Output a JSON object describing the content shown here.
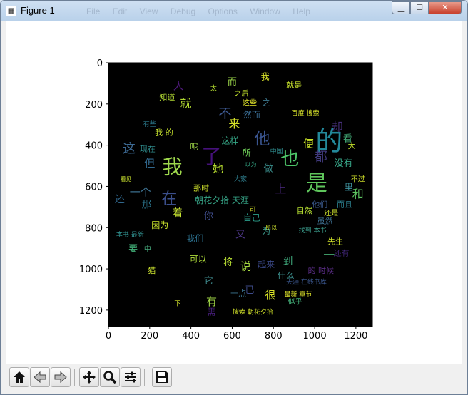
{
  "window": {
    "title": "Figure 1",
    "ghost_menu": "File  Edit  View  Debug  Options  Window  Help",
    "buttons": {
      "minimize": "minimize-icon",
      "maximize": "maximize-icon",
      "close": "close-icon"
    }
  },
  "toolbar": {
    "items": [
      {
        "name": "home-button",
        "icon": "home-icon"
      },
      {
        "name": "back-button",
        "icon": "back-arrow-icon"
      },
      {
        "name": "forward-button",
        "icon": "forward-arrow-icon"
      },
      {
        "name": "pan-button",
        "icon": "move-icon"
      },
      {
        "name": "zoom-button",
        "icon": "magnifier-icon"
      },
      {
        "name": "configure-subplots-button",
        "icon": "sliders-icon"
      },
      {
        "name": "save-button",
        "icon": "floppy-disk-icon"
      }
    ]
  },
  "chart_data": {
    "type": "wordcloud",
    "xticks": [
      0,
      200,
      400,
      600,
      800,
      1000,
      1200
    ],
    "yticks": [
      0,
      200,
      400,
      600,
      800,
      1000,
      1200
    ],
    "xlim": [
      0,
      1280
    ],
    "ylim": [
      1280,
      0
    ],
    "background": "#000000",
    "words": [
      {
        "text": "的",
        "x": 1070,
        "y": 390,
        "size": 38,
        "color": "#23889a"
      },
      {
        "text": "是",
        "x": 1010,
        "y": 590,
        "size": 30,
        "color": "#5fc65c"
      },
      {
        "text": "我",
        "x": 310,
        "y": 510,
        "size": 28,
        "color": "#9ed84c"
      },
      {
        "text": "了",
        "x": 500,
        "y": 460,
        "size": 28,
        "color": "#45117a"
      },
      {
        "text": "也",
        "x": 880,
        "y": 470,
        "size": 26,
        "color": "#4ec76a"
      },
      {
        "text": "他",
        "x": 745,
        "y": 375,
        "size": 22,
        "color": "#3a5590"
      },
      {
        "text": "在",
        "x": 295,
        "y": 665,
        "size": 22,
        "color": "#3b4f8c"
      },
      {
        "text": "这",
        "x": 100,
        "y": 420,
        "size": 18,
        "color": "#3d6a94"
      },
      {
        "text": "不",
        "x": 565,
        "y": 250,
        "size": 18,
        "color": "#3e5a93"
      },
      {
        "text": "都",
        "x": 1030,
        "y": 460,
        "size": 18,
        "color": "#40397c"
      },
      {
        "text": "却",
        "x": 1110,
        "y": 315,
        "size": 16,
        "color": "#462f7a"
      },
      {
        "text": "就",
        "x": 375,
        "y": 200,
        "size": 16,
        "color": "#b4dc32"
      },
      {
        "text": "人",
        "x": 340,
        "y": 115,
        "size": 15,
        "color": "#50197e"
      },
      {
        "text": "而",
        "x": 600,
        "y": 95,
        "size": 13,
        "color": "#9dd94a"
      },
      {
        "text": "来",
        "x": 610,
        "y": 300,
        "size": 16,
        "color": "#d6e228"
      },
      {
        "text": "便",
        "x": 970,
        "y": 395,
        "size": 15,
        "color": "#c9e228"
      },
      {
        "text": "看",
        "x": 1160,
        "y": 370,
        "size": 13,
        "color": "#44b07a"
      },
      {
        "text": "没有",
        "x": 1140,
        "y": 490,
        "size": 13,
        "color": "#38a88a"
      },
      {
        "text": "和",
        "x": 1210,
        "y": 640,
        "size": 16,
        "color": "#5ec662"
      },
      {
        "text": "上",
        "x": 835,
        "y": 615,
        "size": 16,
        "color": "#4e2a84"
      },
      {
        "text": "但",
        "x": 200,
        "y": 490,
        "size": 15,
        "color": "#31688e"
      },
      {
        "text": "一个",
        "x": 155,
        "y": 630,
        "size": 15,
        "color": "#3d7190"
      },
      {
        "text": "还",
        "x": 55,
        "y": 665,
        "size": 14,
        "color": "#31688e"
      },
      {
        "text": "那",
        "x": 185,
        "y": 690,
        "size": 14,
        "color": "#2d7891"
      },
      {
        "text": "着",
        "x": 335,
        "y": 730,
        "size": 15,
        "color": "#c5e132"
      },
      {
        "text": "你",
        "x": 485,
        "y": 745,
        "size": 13,
        "color": "#3e4c8a"
      },
      {
        "text": "她",
        "x": 530,
        "y": 515,
        "size": 15,
        "color": "#b9de30"
      },
      {
        "text": "做",
        "x": 775,
        "y": 515,
        "size": 13,
        "color": "#3a8e8c"
      },
      {
        "text": "所",
        "x": 670,
        "y": 440,
        "size": 12,
        "color": "#6ecf58"
      },
      {
        "text": "这样",
        "x": 590,
        "y": 380,
        "size": 12,
        "color": "#35a484"
      },
      {
        "text": "然而",
        "x": 695,
        "y": 255,
        "size": 12,
        "color": "#3a6d94"
      },
      {
        "text": "朝花夕拾 天涯",
        "x": 550,
        "y": 670,
        "size": 12,
        "color": "#35a184"
      },
      {
        "text": "自己",
        "x": 695,
        "y": 755,
        "size": 12,
        "color": "#2c9f8c"
      },
      {
        "text": "又",
        "x": 640,
        "y": 835,
        "size": 14,
        "color": "#4a3583"
      },
      {
        "text": "为",
        "x": 765,
        "y": 820,
        "size": 12,
        "color": "#3c9a8c"
      },
      {
        "text": "我们",
        "x": 420,
        "y": 855,
        "size": 12,
        "color": "#2c718f"
      },
      {
        "text": "因为",
        "x": 250,
        "y": 790,
        "size": 12,
        "color": "#c8e02c"
      },
      {
        "text": "要",
        "x": 120,
        "y": 905,
        "size": 13,
        "color": "#43b27a"
      },
      {
        "text": "中",
        "x": 190,
        "y": 905,
        "size": 10,
        "color": "#46a97c"
      },
      {
        "text": "可以",
        "x": 435,
        "y": 955,
        "size": 12,
        "color": "#aedb3a"
      },
      {
        "text": "将",
        "x": 580,
        "y": 970,
        "size": 13,
        "color": "#b7dd32"
      },
      {
        "text": "说",
        "x": 665,
        "y": 990,
        "size": 15,
        "color": "#a5d840"
      },
      {
        "text": "起来",
        "x": 765,
        "y": 980,
        "size": 12,
        "color": "#3c4a8b"
      },
      {
        "text": "到",
        "x": 870,
        "y": 965,
        "size": 14,
        "color": "#40ac7e"
      },
      {
        "text": "一",
        "x": 1070,
        "y": 935,
        "size": 16,
        "color": "#49b87a"
      },
      {
        "text": "还有",
        "x": 1130,
        "y": 925,
        "size": 11,
        "color": "#43277c"
      },
      {
        "text": "先生",
        "x": 1100,
        "y": 870,
        "size": 11,
        "color": "#d0e22a"
      },
      {
        "text": "什么",
        "x": 860,
        "y": 1035,
        "size": 12,
        "color": "#3b8e8c"
      },
      {
        "text": "的 时候",
        "x": 1030,
        "y": 1010,
        "size": 11,
        "color": "#5a2d86"
      },
      {
        "text": "虽然",
        "x": 1050,
        "y": 770,
        "size": 11,
        "color": "#3d6f90"
      },
      {
        "text": "还是",
        "x": 1080,
        "y": 730,
        "size": 10,
        "color": "#cde02c"
      },
      {
        "text": "他们",
        "x": 1025,
        "y": 690,
        "size": 11,
        "color": "#3b5a8f"
      },
      {
        "text": "而且",
        "x": 1145,
        "y": 690,
        "size": 11,
        "color": "#2c7f8e"
      },
      {
        "text": "自然",
        "x": 950,
        "y": 720,
        "size": 11,
        "color": "#b5de32"
      },
      {
        "text": "不过",
        "x": 1210,
        "y": 565,
        "size": 10,
        "color": "#d2e22a"
      },
      {
        "text": "里",
        "x": 1165,
        "y": 605,
        "size": 12,
        "color": "#3f94a0"
      },
      {
        "text": "很",
        "x": 785,
        "y": 1130,
        "size": 15,
        "color": "#d8e228"
      },
      {
        "text": "已",
        "x": 685,
        "y": 1105,
        "size": 13,
        "color": "#3e4b8a"
      },
      {
        "text": "一点",
        "x": 630,
        "y": 1120,
        "size": 11,
        "color": "#3c7490"
      },
      {
        "text": "它",
        "x": 485,
        "y": 1060,
        "size": 13,
        "color": "#3f8b8e"
      },
      {
        "text": "有",
        "x": 500,
        "y": 1160,
        "size": 15,
        "color": "#a0d646"
      },
      {
        "text": "需",
        "x": 500,
        "y": 1210,
        "size": 12,
        "color": "#4a1f80"
      },
      {
        "text": "猫",
        "x": 210,
        "y": 1010,
        "size": 11,
        "color": "#c9e02e"
      },
      {
        "text": "知道",
        "x": 285,
        "y": 170,
        "size": 11,
        "color": "#b4dc34"
      },
      {
        "text": "之后",
        "x": 645,
        "y": 150,
        "size": 10,
        "color": "#c1df2c"
      },
      {
        "text": "这些",
        "x": 685,
        "y": 195,
        "size": 10,
        "color": "#dfe22a"
      },
      {
        "text": "就是",
        "x": 900,
        "y": 110,
        "size": 11,
        "color": "#c6e02c"
      },
      {
        "text": "现在",
        "x": 190,
        "y": 420,
        "size": 11,
        "color": "#2f8b8c"
      },
      {
        "text": "呢",
        "x": 415,
        "y": 410,
        "size": 11,
        "color": "#9fd748"
      },
      {
        "text": "我 的",
        "x": 270,
        "y": 340,
        "size": 11,
        "color": "#c4df2e"
      },
      {
        "text": "那时",
        "x": 450,
        "y": 610,
        "size": 11,
        "color": "#cfe12c"
      },
      {
        "text": "大家",
        "x": 640,
        "y": 565,
        "size": 9,
        "color": "#2f7f8e"
      },
      {
        "text": "中国",
        "x": 815,
        "y": 430,
        "size": 9,
        "color": "#2e8a8c"
      },
      {
        "text": "百度 搜索",
        "x": 955,
        "y": 245,
        "size": 9,
        "color": "#d8e22a"
      },
      {
        "text": "搜索 朝花夕拾",
        "x": 700,
        "y": 1210,
        "size": 9,
        "color": "#d2e22a"
      },
      {
        "text": "最新 章节",
        "x": 920,
        "y": 1125,
        "size": 9,
        "color": "#dde22a"
      },
      {
        "text": "似乎",
        "x": 905,
        "y": 1160,
        "size": 10,
        "color": "#45b47c"
      },
      {
        "text": "天涯 在线书库",
        "x": 960,
        "y": 1065,
        "size": 9,
        "color": "#3b578f"
      },
      {
        "text": "找到 本书",
        "x": 990,
        "y": 815,
        "size": 9,
        "color": "#3a9a8a"
      },
      {
        "text": "本书 最新",
        "x": 105,
        "y": 835,
        "size": 9,
        "color": "#2f8d8c"
      },
      {
        "text": "看见",
        "x": 85,
        "y": 565,
        "size": 8,
        "color": "#c8e02e"
      },
      {
        "text": "有些",
        "x": 200,
        "y": 300,
        "size": 9,
        "color": "#2c7b8e"
      },
      {
        "text": "我",
        "x": 760,
        "y": 70,
        "size": 12,
        "color": "#d8e22a"
      },
      {
        "text": "之",
        "x": 765,
        "y": 195,
        "size": 12,
        "color": "#3e7a90"
      },
      {
        "text": "太",
        "x": 510,
        "y": 125,
        "size": 9,
        "color": "#b5dd30"
      },
      {
        "text": "大",
        "x": 1180,
        "y": 405,
        "size": 11,
        "color": "#c2df2c"
      },
      {
        "text": "以为",
        "x": 690,
        "y": 495,
        "size": 8,
        "color": "#33a382"
      },
      {
        "text": "所以",
        "x": 790,
        "y": 800,
        "size": 8,
        "color": "#cde02e"
      },
      {
        "text": "下",
        "x": 335,
        "y": 1170,
        "size": 9,
        "color": "#d0e02c"
      },
      {
        "text": "可",
        "x": 700,
        "y": 715,
        "size": 9,
        "color": "#d6e22a"
      }
    ]
  }
}
